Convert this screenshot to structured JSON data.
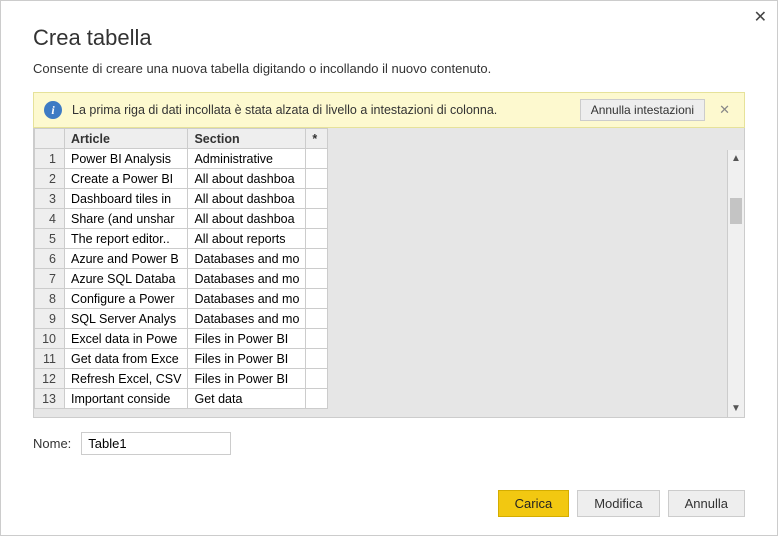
{
  "close_label": "✕",
  "title": "Crea tabella",
  "subtitle": "Consente di creare una nuova tabella digitando o incollando il nuovo contenuto.",
  "banner": {
    "text": "La prima riga di dati incollata è stata alzata di livello a intestazioni di colonna.",
    "undo_label": "Annulla intestazioni",
    "close": "✕"
  },
  "grid": {
    "headers": {
      "article": "Article",
      "section": "Section",
      "star": "*"
    },
    "rows": [
      {
        "n": "1",
        "article": "Power BI Analysis",
        "section": "Administrative"
      },
      {
        "n": "2",
        "article": "Create a Power BI",
        "section": "All about dashboa"
      },
      {
        "n": "3",
        "article": "Dashboard tiles in",
        "section": "All about dashboa"
      },
      {
        "n": "4",
        "article": "Share (and unshar",
        "section": "All about dashboa"
      },
      {
        "n": "5",
        "article": "The report editor..",
        "section": "All about reports"
      },
      {
        "n": "6",
        "article": "Azure and Power B",
        "section": "Databases and mo"
      },
      {
        "n": "7",
        "article": "Azure SQL Databa",
        "section": "Databases and mo"
      },
      {
        "n": "8",
        "article": "Configure a Power",
        "section": "Databases and mo"
      },
      {
        "n": "9",
        "article": "SQL Server Analys",
        "section": "Databases and mo"
      },
      {
        "n": "10",
        "article": "Excel data in Powe",
        "section": "Files in Power BI"
      },
      {
        "n": "11",
        "article": "Get data from Exce",
        "section": "Files in Power BI"
      },
      {
        "n": "12",
        "article": "Refresh Excel, CSV",
        "section": "Files in Power BI"
      },
      {
        "n": "13",
        "article": "Important conside",
        "section": "Get data"
      }
    ]
  },
  "name_label": "Nome:",
  "name_value": "Table1",
  "footer": {
    "load": "Carica",
    "edit": "Modifica",
    "cancel": "Annulla"
  }
}
